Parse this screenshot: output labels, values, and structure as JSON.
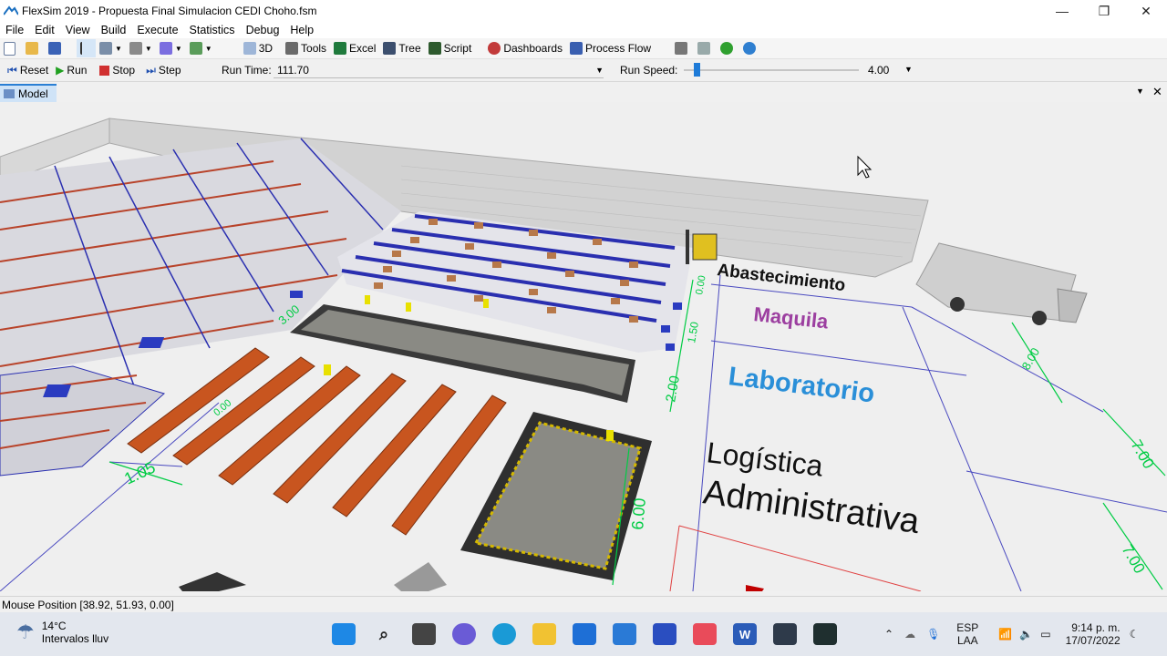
{
  "window": {
    "title": "FlexSim 2019 - Propuesta Final Simulacion CEDI Choho.fsm",
    "controls": [
      "—",
      "❐",
      "✕"
    ]
  },
  "menu": [
    "File",
    "Edit",
    "View",
    "Build",
    "Execute",
    "Statistics",
    "Debug",
    "Help"
  ],
  "toolbar": {
    "view3d": "3D",
    "tools": "Tools",
    "excel": "Excel",
    "tree": "Tree",
    "script": "Script",
    "dashboards": "Dashboards",
    "process_flow": "Process Flow"
  },
  "runbar": {
    "reset": "Reset",
    "run": "Run",
    "stop": "Stop",
    "step": "Step",
    "run_time_label": "Run Time:",
    "run_time_value": "111.70",
    "run_speed_label": "Run Speed:",
    "run_speed_value": "4.00"
  },
  "tabs": {
    "model": "Model"
  },
  "scene": {
    "zones": {
      "abastecimiento": "Abastecimiento",
      "maquila": "Maquila",
      "laboratorio": "Laboratorio",
      "logistica_1": "Logística",
      "logistica_2": "Administrativa"
    },
    "dimensions": {
      "d1": "3.00",
      "d2": "1.05",
      "d3": "2.00",
      "d4": "1.50",
      "d5": "0.00",
      "d6": "6.00",
      "d7": "8.00",
      "d8": "7.00",
      "d9": "7.00",
      "d10": "0.00"
    },
    "colors": {
      "zone_maquila": "#9c3fa0",
      "zone_laboratorio": "#2a8fd8",
      "rack_blue": "#2a2fb0",
      "rack_orange": "#c8551f",
      "wall": "#d6d6d6",
      "dimension_green": "#00cc44"
    }
  },
  "status": {
    "mouse_position": "Mouse Position [38.92, 51.93, 0.00]"
  },
  "taskbar": {
    "weather_temp": "14°C",
    "weather_desc": "Intervalos lluv",
    "lang_1": "ESP",
    "lang_2": "LAA",
    "time": "9:14 p. m.",
    "date": "17/07/2022"
  }
}
